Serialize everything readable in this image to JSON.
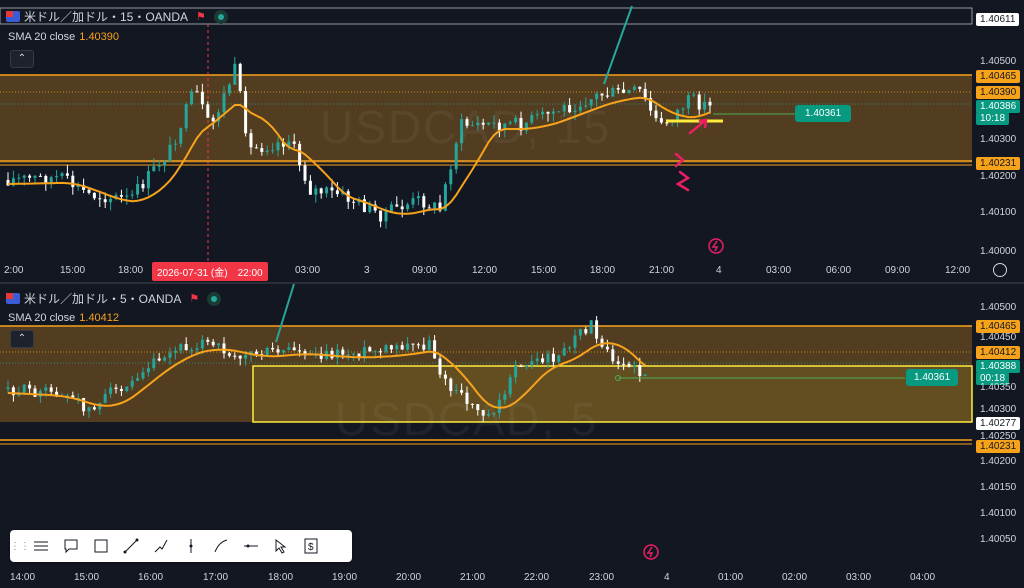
{
  "top": {
    "symbol": "米ドル／加ドル・15・OANDA",
    "indicator_name": "SMA 20 close",
    "indicator_value": "1.40390",
    "watermark": "USDCAD, 15",
    "price_axis": [
      "1.40611",
      "1.40500",
      "1.40465",
      "1.40390",
      "1.40386",
      "10:18",
      "1.40300",
      "1.40231",
      "1.40200",
      "1.40100",
      "1.40000"
    ],
    "time_axis": [
      "2:00",
      "15:00",
      "18:00",
      "2026-07-31 (金)　22:00",
      "03:00",
      "3",
      "09:00",
      "12:00",
      "15:00",
      "18:00",
      "21:00",
      "4",
      "03:00",
      "06:00",
      "09:00",
      "12:00"
    ],
    "callout_price": "1.40361",
    "crosshair_time": "2026-07-31 (金)　22:00"
  },
  "bottom": {
    "symbol": "米ドル／加ドル・5・OANDA",
    "indicator_name": "SMA 20 close",
    "indicator_value": "1.40412",
    "watermark": "USDCAD, 5",
    "price_axis": [
      "1.40500",
      "1.40465",
      "1.40450",
      "1.40412",
      "1.40388",
      "00:18",
      "1.40350",
      "1.40300",
      "1.40277",
      "1.40250",
      "1.40231",
      "1.40200",
      "1.40150",
      "1.40100",
      "1.40050"
    ],
    "time_axis": [
      "14:00",
      "15:00",
      "16:00",
      "17:00",
      "18:00",
      "19:00",
      "20:00",
      "21:00",
      "22:00",
      "23:00",
      "4",
      "01:00",
      "02:00",
      "03:00",
      "04:00"
    ],
    "callout_price": "1.40361"
  },
  "toolbar": {
    "items": [
      "lines-icon",
      "comment-icon",
      "rectangle-icon",
      "trendline-icon",
      "path-icon",
      "vertical-line-icon",
      "brush-icon",
      "horizontal-ray-icon",
      "cursor-icon",
      "price-label-icon"
    ]
  },
  "colors": {
    "background": "#131722",
    "up": "#26a69a",
    "down": "#ffffff",
    "sma": "#f7a21b",
    "zone": "#f7a21b",
    "highlight": "#ffeb3b",
    "annotation": "#e91e63",
    "callout": "#089981"
  }
}
